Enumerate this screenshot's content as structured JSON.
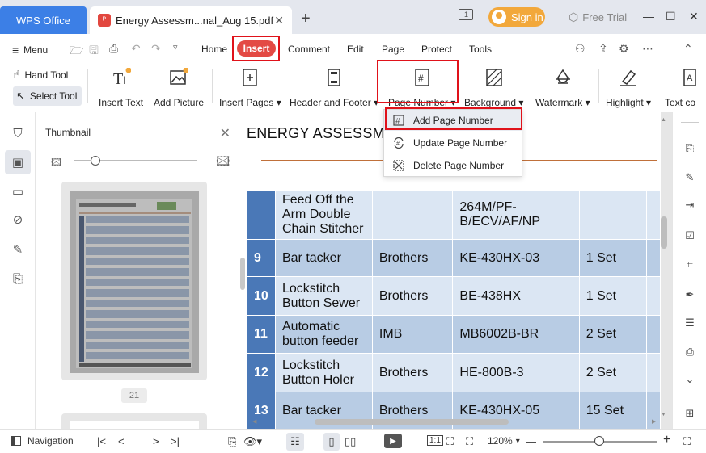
{
  "titlebar": {
    "app_tab": "WPS Office",
    "doc_tab": "Energy Assessm...nal_Aug 15.pdf",
    "sign_in": "Sign in",
    "free_trial": "Free Trial"
  },
  "menubar": {
    "menu": "Menu",
    "tabs": [
      "Home",
      "Insert",
      "Comment",
      "Edit",
      "Page",
      "Protect",
      "Tools"
    ]
  },
  "ribbon": {
    "hand_tool": "Hand Tool",
    "select_tool": "Select Tool",
    "insert_text": "Insert Text",
    "insert_picture": "Add Picture",
    "insert_pages": "Insert Pages",
    "header_footer": "Header and Footer",
    "page_number": "Page Number",
    "background": "Background",
    "watermark": "Watermark",
    "highlight": "Highlight",
    "text_co": "Text co"
  },
  "dropdown": {
    "items": [
      "Add Page Number",
      "Update Page Number",
      "Delete Page Number"
    ]
  },
  "thumbnail": {
    "title": "Thumbnail",
    "page_number": "21"
  },
  "document": {
    "heading": "ENERGY ASSESSME",
    "rows": [
      {
        "num": "",
        "name": "Feed Off the Arm Double Chain Stitcher",
        "brand": "",
        "model": "264M/PF-B/ECV/AF/NP",
        "qty": ""
      },
      {
        "num": "9",
        "name": "Bar tacker",
        "brand": "Brothers",
        "model": "KE-430HX-03",
        "qty": "1 Set"
      },
      {
        "num": "10",
        "name": "Lockstitch Button Sewer",
        "brand": "Brothers",
        "model": "BE-438HX",
        "qty": "1 Set"
      },
      {
        "num": "11",
        "name": "Automatic button feeder",
        "brand": "IMB",
        "model": "MB6002B-BR",
        "qty": "2 Set"
      },
      {
        "num": "12",
        "name": "Lockstitch Button Holer",
        "brand": "Brothers",
        "model": "HE-800B-3",
        "qty": "2 Set"
      },
      {
        "num": "13",
        "name": "Bar tacker",
        "brand": "Brothers",
        "model": "KE-430HX-05",
        "qty": "15 Set"
      }
    ]
  },
  "statusbar": {
    "navigation": "Navigation",
    "zoom": "120%"
  }
}
